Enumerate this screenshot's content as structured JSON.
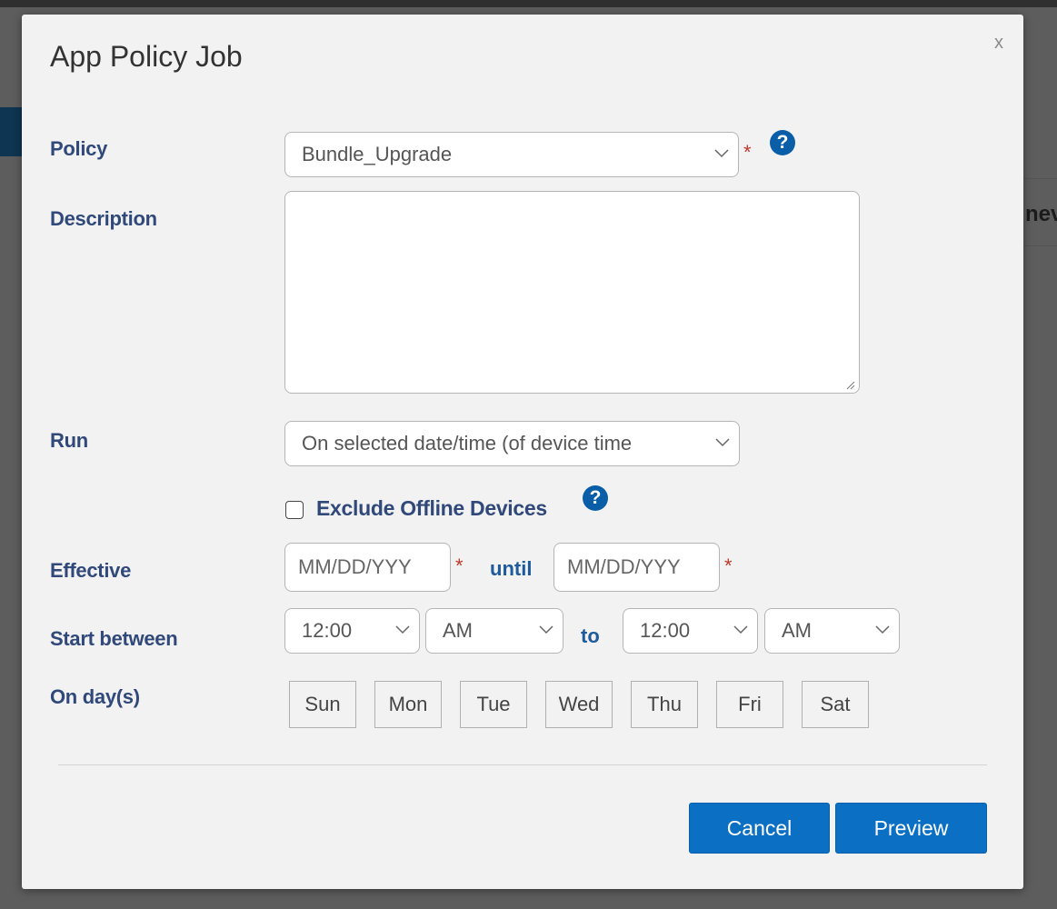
{
  "background": {
    "side_text": "nev"
  },
  "modal": {
    "title": "App Policy Job",
    "close_label": "x"
  },
  "form": {
    "policy": {
      "label": "Policy",
      "value": "Bundle_Upgrade",
      "required_mark": "*"
    },
    "description": {
      "label": "Description",
      "value": ""
    },
    "run": {
      "label": "Run",
      "value": "On selected date/time (of device time"
    },
    "exclude_offline": {
      "label": "Exclude Offline Devices",
      "checked": false
    },
    "effective": {
      "label": "Effective",
      "from_placeholder": "MM/DD/YYY",
      "until_word": "until",
      "to_placeholder": "MM/DD/YYY",
      "required_mark": "*"
    },
    "start_between": {
      "label": "Start between",
      "from_time": "12:00",
      "from_ampm": "AM",
      "to_word": "to",
      "to_time": "12:00",
      "to_ampm": "AM"
    },
    "days": {
      "label": "On day(s)",
      "items": [
        "Sun",
        "Mon",
        "Tue",
        "Wed",
        "Thu",
        "Fri",
        "Sat"
      ]
    }
  },
  "help_icon_glyph": "?",
  "footer": {
    "cancel_label": "Cancel",
    "preview_label": "Preview"
  },
  "colors": {
    "primary": "#0b6fc4",
    "label": "#30497a",
    "required": "#c0392b",
    "help": "#0a5ea8"
  }
}
